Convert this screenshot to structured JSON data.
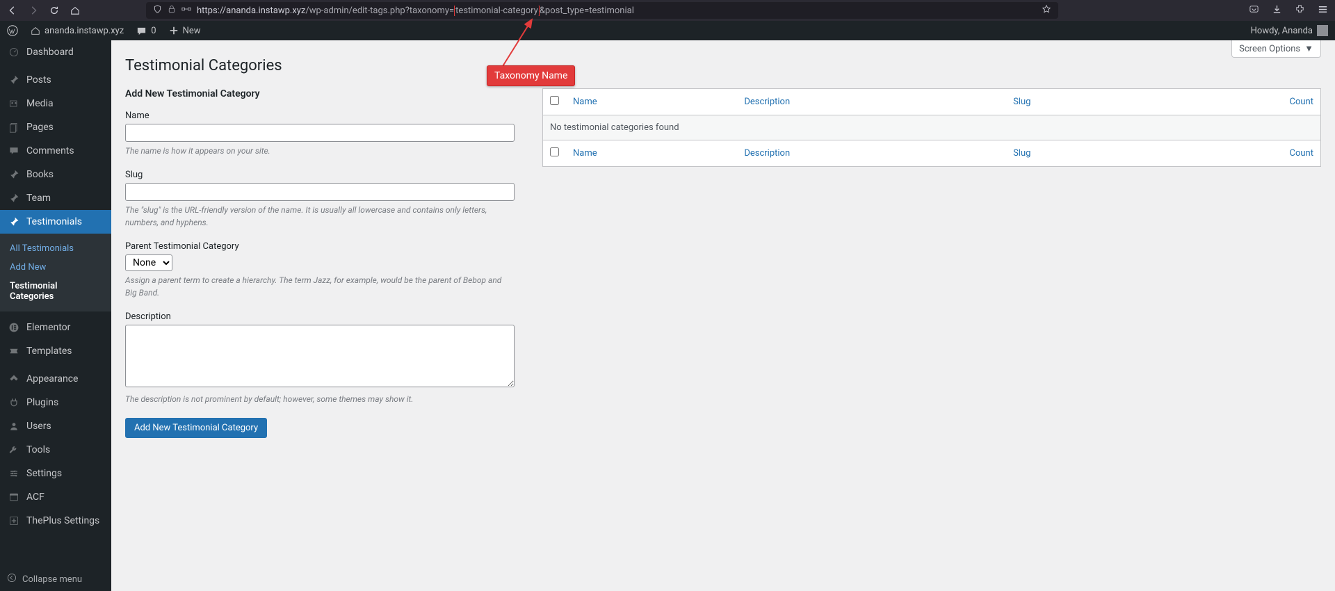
{
  "browser": {
    "url_prefix": "https://ananda.instawp.xyz",
    "url_mid": "/wp-admin/edit-tags.php?taxonomy=",
    "url_highlight": "testimonial-category",
    "url_suffix": "&post_type=testimonial"
  },
  "wp_topbar": {
    "site_name": "ananda.instawp.xyz",
    "comments_count": "0",
    "new_label": "New",
    "howdy": "Howdy, Ananda"
  },
  "sidebar": {
    "dashboard": "Dashboard",
    "posts": "Posts",
    "media": "Media",
    "pages": "Pages",
    "comments": "Comments",
    "books": "Books",
    "team": "Team",
    "testimonials": "Testimonials",
    "sub_all": "All Testimonials",
    "sub_add": "Add New",
    "sub_cat": "Testimonial Categories",
    "elementor": "Elementor",
    "templates": "Templates",
    "appearance": "Appearance",
    "plugins": "Plugins",
    "users": "Users",
    "tools": "Tools",
    "settings": "Settings",
    "acf": "ACF",
    "theplus": "ThePlus Settings",
    "collapse": "Collapse menu"
  },
  "content": {
    "screen_options": "Screen Options",
    "page_title": "Testimonial Categories",
    "form_title": "Add New Testimonial Category",
    "name_label": "Name",
    "name_help": "The name is how it appears on your site.",
    "slug_label": "Slug",
    "slug_help": "The \"slug\" is the URL-friendly version of the name. It is usually all lowercase and contains only letters, numbers, and hyphens.",
    "parent_label": "Parent Testimonial Category",
    "parent_option_none": "None",
    "parent_help": "Assign a parent term to create a hierarchy. The term Jazz, for example, would be the parent of Bebop and Big Band.",
    "desc_label": "Description",
    "desc_help": "The description is not prominent by default; however, some themes may show it.",
    "submit_label": "Add New Testimonial Category"
  },
  "table": {
    "col_name": "Name",
    "col_desc": "Description",
    "col_slug": "Slug",
    "col_count": "Count",
    "no_items": "No testimonial categories found"
  },
  "annotation": {
    "label": "Taxonomy Name"
  }
}
